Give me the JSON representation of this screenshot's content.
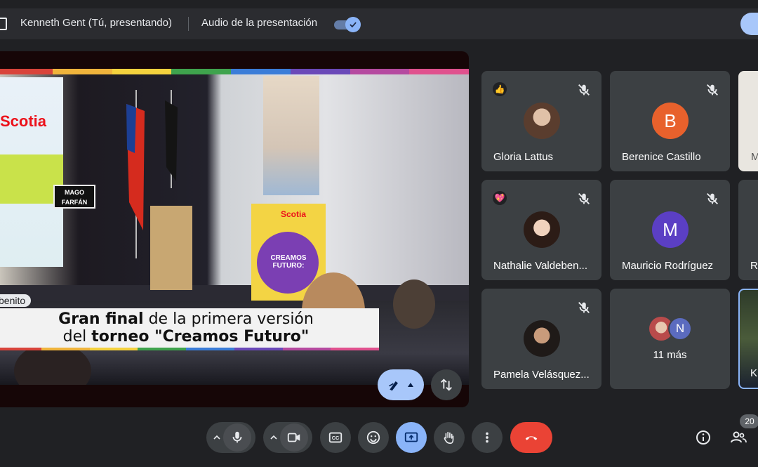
{
  "topbar": {
    "presenter_label": "Kenneth Gent (Tú, presentando)",
    "audio_label": "Audio de la presentación",
    "audio_toggle_on": true
  },
  "presentation": {
    "name_tag": "benito",
    "caption_line1_bold": "Gran final",
    "caption_line1_rest": " de la primera versión",
    "caption_line2_pre": "del ",
    "caption_line2_bold": "torneo \"Creamos Futuro\"",
    "screen_brand": "Scotia",
    "poster_brand": "Scotia",
    "poster_text": "CREAMOS FUTURO:",
    "podium_sign": "MAGO FARFÁN",
    "strip_colors": [
      "#d9443b",
      "#f0b43c",
      "#f4d23e",
      "#3fa34d",
      "#3b7dd8",
      "#6a49b8",
      "#b54aa0",
      "#e0518e"
    ]
  },
  "tiles": [
    {
      "name": "Gloria Lattus",
      "reaction": "👍",
      "muted": true,
      "avatar_letter": "",
      "avatar_color": ""
    },
    {
      "name": "Berenice Castillo",
      "reaction": "",
      "muted": true,
      "avatar_letter": "B",
      "avatar_color": "#e8612c"
    },
    {
      "name": "Nathalie Valdeben...",
      "reaction": "💖",
      "muted": true,
      "avatar_letter": "",
      "avatar_color": ""
    },
    {
      "name": "Mauricio Rodríguez",
      "reaction": "",
      "muted": true,
      "avatar_letter": "M",
      "avatar_color": "#5b3fc4"
    },
    {
      "name": "Pamela Velásquez...",
      "reaction": "",
      "muted": true,
      "avatar_letter": "",
      "avatar_color": ""
    },
    {
      "name": "",
      "more_label": "11 más",
      "second_avatar_letter": "N"
    }
  ],
  "partial_tiles": [
    {
      "name": "M"
    },
    {
      "name": "Ri"
    },
    {
      "name": "K"
    }
  ],
  "controls": {
    "mic": "microphone-icon",
    "camera": "videocam-icon",
    "captions": "closed-captions-icon",
    "emoji": "emoji-icon",
    "present": "present-screen-icon",
    "hand": "raise-hand-icon",
    "more": "more-vert-icon",
    "end": "call-end-icon",
    "participants_count": "20"
  },
  "colors": {
    "accent": "#8ab4f8",
    "end_call": "#ea4335",
    "tile_bg": "#3c4043"
  }
}
